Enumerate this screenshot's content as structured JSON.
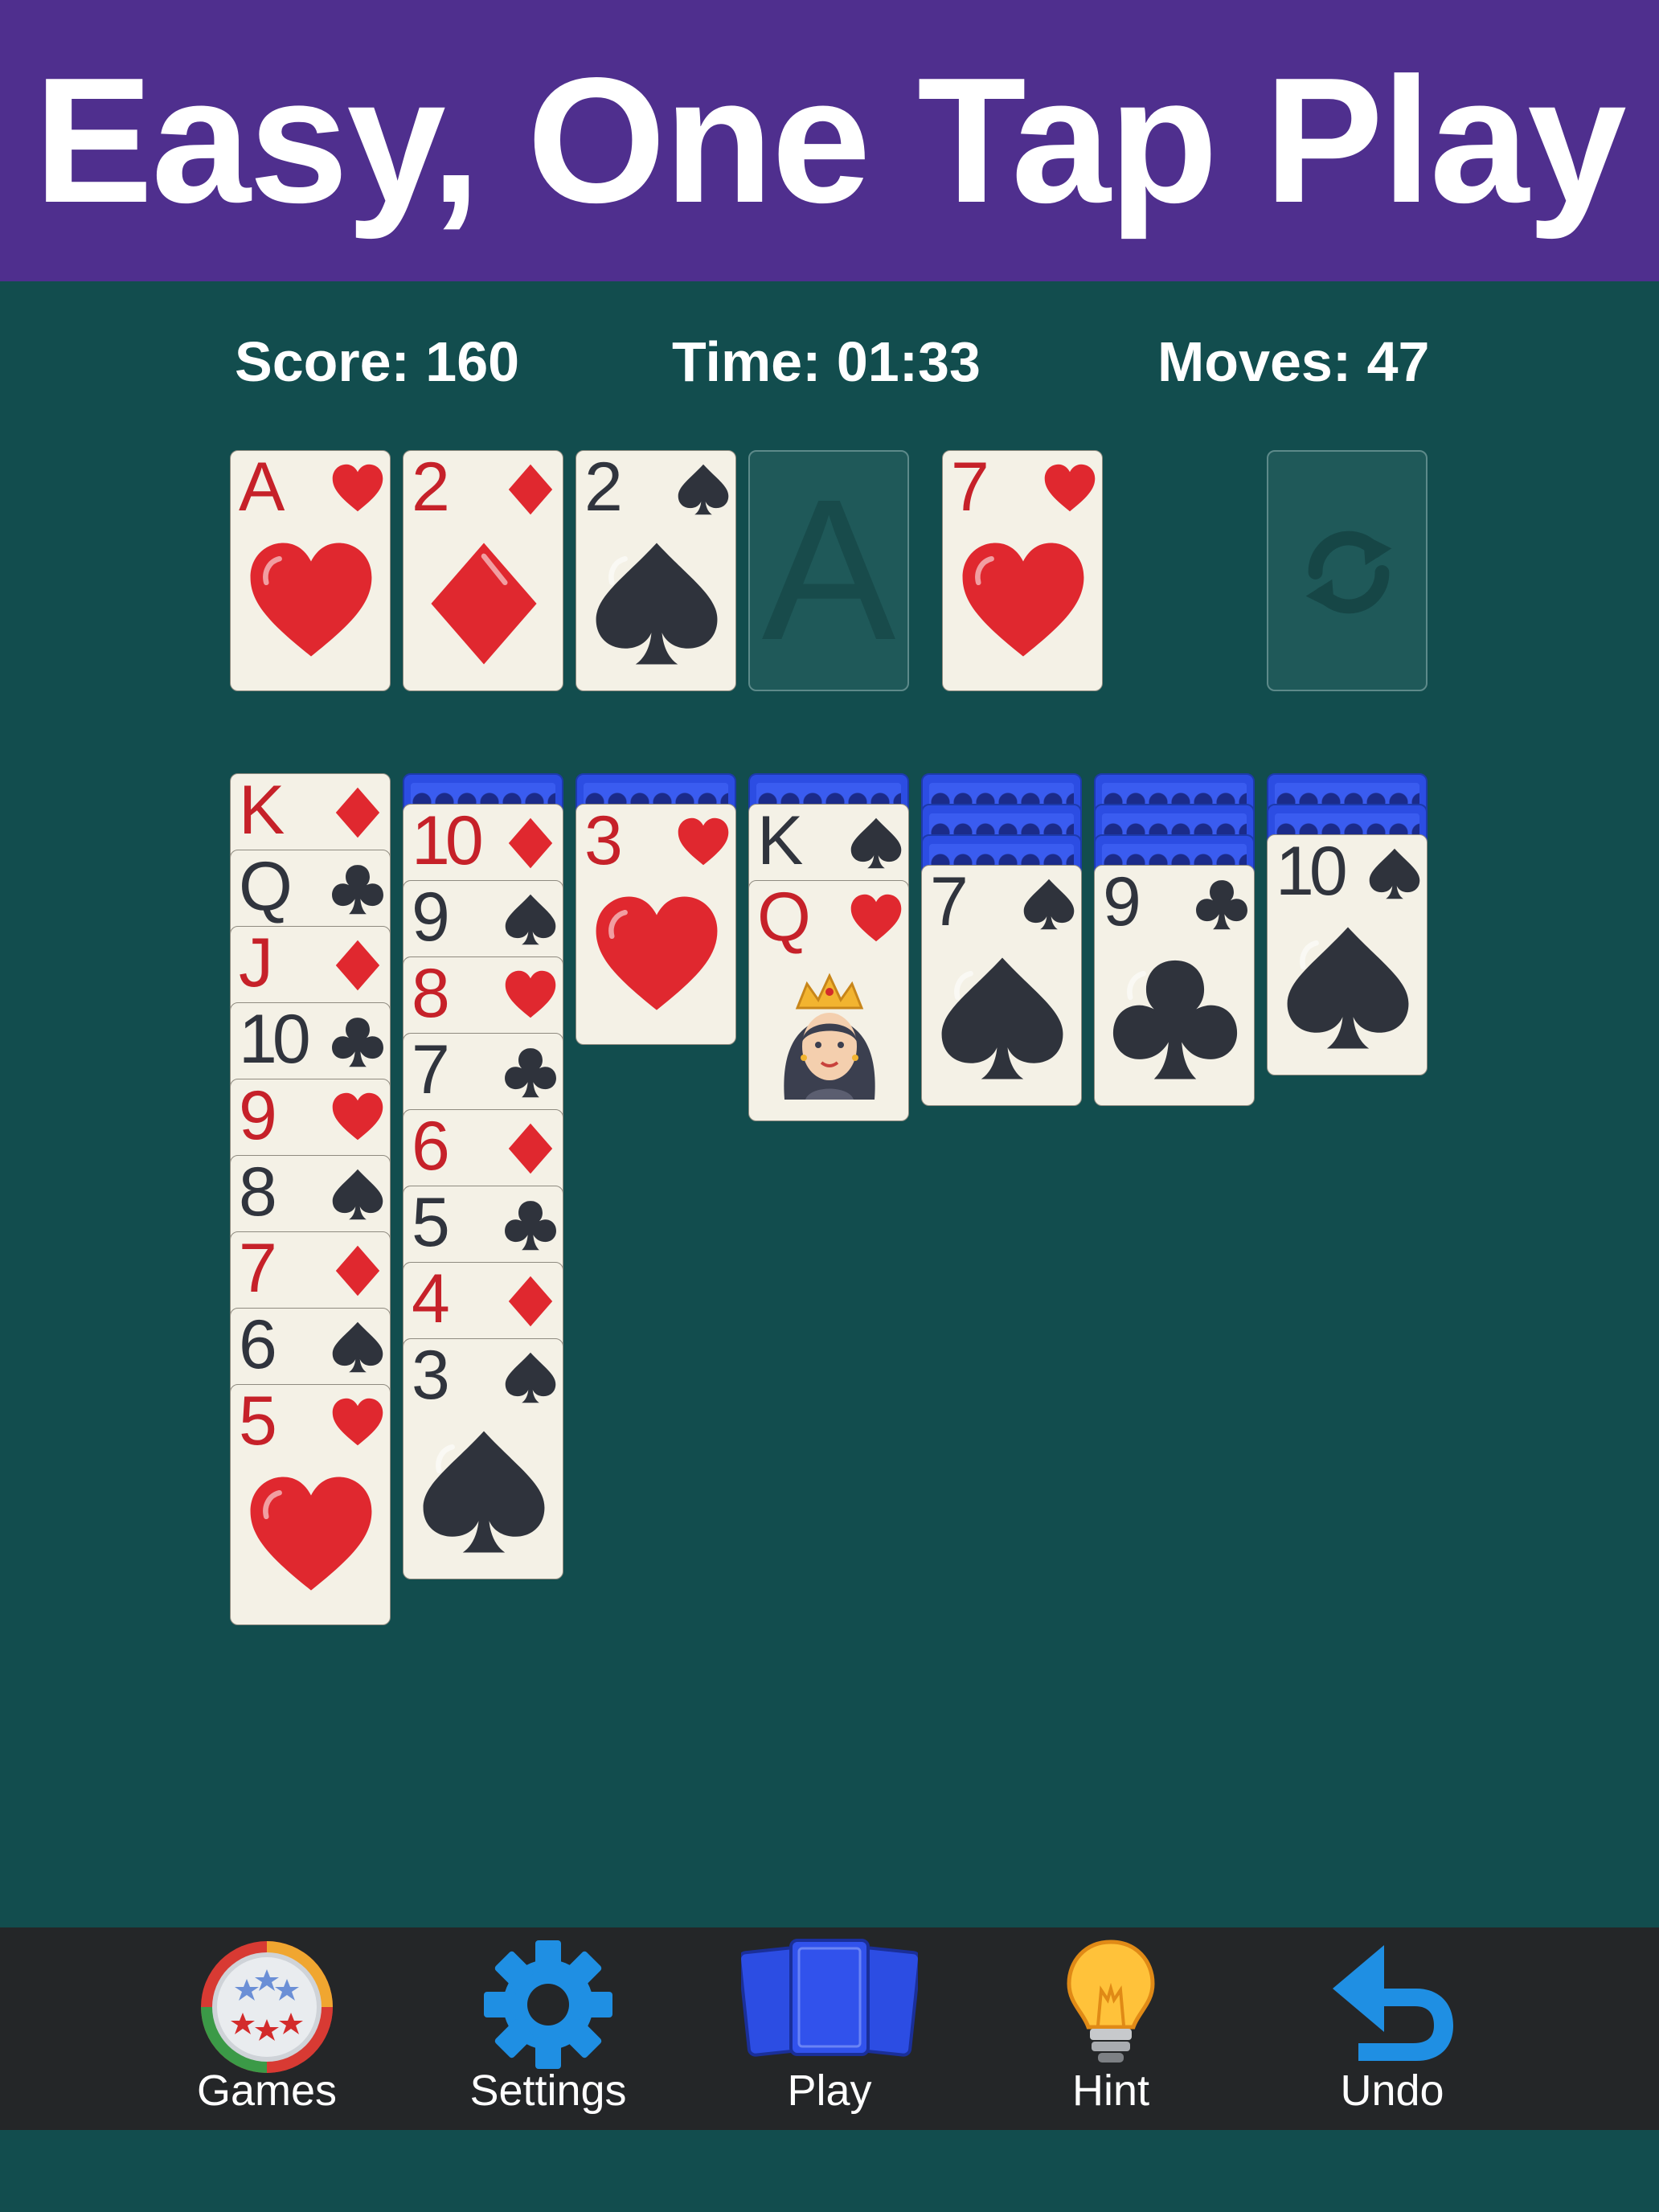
{
  "banner": {
    "title": "Easy, One Tap Play"
  },
  "status": {
    "score": "Score: 160",
    "time": "Time: 01:33",
    "moves": "Moves: 47"
  },
  "foundations": [
    {
      "rank": "A",
      "suit": "hearts"
    },
    {
      "rank": "2",
      "suit": "diamonds"
    },
    {
      "rank": "2",
      "suit": "spades"
    },
    {
      "rank": "A",
      "suit": "empty"
    }
  ],
  "waste": {
    "rank": "7",
    "suit": "hearts"
  },
  "stock": {
    "icon": "refresh-icon"
  },
  "tableau": [
    {
      "hidden": 0,
      "cards": [
        {
          "rank": "K",
          "suit": "diamonds"
        },
        {
          "rank": "Q",
          "suit": "clubs"
        },
        {
          "rank": "J",
          "suit": "diamonds"
        },
        {
          "rank": "10",
          "suit": "clubs"
        },
        {
          "rank": "9",
          "suit": "hearts"
        },
        {
          "rank": "8",
          "suit": "spades"
        },
        {
          "rank": "7",
          "suit": "diamonds"
        },
        {
          "rank": "6",
          "suit": "spades"
        },
        {
          "rank": "5",
          "suit": "hearts"
        }
      ]
    },
    {
      "hidden": 1,
      "cards": [
        {
          "rank": "10",
          "suit": "diamonds"
        },
        {
          "rank": "9",
          "suit": "spades"
        },
        {
          "rank": "8",
          "suit": "hearts"
        },
        {
          "rank": "7",
          "suit": "clubs"
        },
        {
          "rank": "6",
          "suit": "diamonds"
        },
        {
          "rank": "5",
          "suit": "clubs"
        },
        {
          "rank": "4",
          "suit": "diamonds"
        },
        {
          "rank": "3",
          "suit": "spades"
        }
      ]
    },
    {
      "hidden": 1,
      "cards": [
        {
          "rank": "3",
          "suit": "hearts"
        }
      ]
    },
    {
      "hidden": 1,
      "cards": [
        {
          "rank": "K",
          "suit": "spades"
        },
        {
          "rank": "Q",
          "suit": "hearts",
          "face": true
        }
      ]
    },
    {
      "hidden": 3,
      "cards": [
        {
          "rank": "7",
          "suit": "spades"
        }
      ]
    },
    {
      "hidden": 3,
      "cards": [
        {
          "rank": "9",
          "suit": "clubs"
        }
      ]
    },
    {
      "hidden": 2,
      "cards": [
        {
          "rank": "10",
          "suit": "spades"
        }
      ]
    }
  ],
  "toolbar": [
    {
      "label": "Games",
      "icon": "games-icon"
    },
    {
      "label": "Settings",
      "icon": "gear-icon"
    },
    {
      "label": "Play",
      "icon": "cards-icon"
    },
    {
      "label": "Hint",
      "icon": "lightbulb-icon"
    },
    {
      "label": "Undo",
      "icon": "undo-icon"
    }
  ],
  "colors": {
    "banner": "#4f2f8e",
    "table": "#124d4e",
    "toolbar": "#242628",
    "red_suit": "#c62129",
    "black_suit": "#30343d",
    "card_back": "#2c4de3"
  }
}
